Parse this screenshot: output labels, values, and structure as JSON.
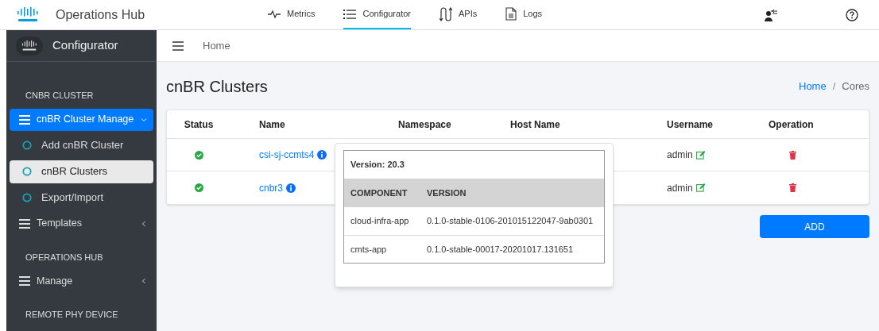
{
  "app": {
    "title": "Operations Hub"
  },
  "nav": [
    {
      "label": "Metrics",
      "kind": "metrics",
      "selected": false
    },
    {
      "label": "Configurator",
      "kind": "list",
      "selected": true
    },
    {
      "label": "APIs",
      "kind": "apis",
      "selected": false
    },
    {
      "label": "Logs",
      "kind": "logs",
      "selected": false
    }
  ],
  "sidebar": {
    "title": "Configurator",
    "sections": [
      {
        "heading": "CNBR CLUSTER",
        "items": [
          {
            "label": "cnBR Cluster Manage",
            "kind": "group",
            "expanded": true,
            "selected": true
          },
          {
            "label": "Add cnBR Cluster",
            "kind": "link",
            "selected": false
          },
          {
            "label": "cnBR Clusters",
            "kind": "link",
            "selected": true
          },
          {
            "label": "Export/Import",
            "kind": "link",
            "selected": false
          },
          {
            "label": "Templates",
            "kind": "group",
            "expanded": false,
            "selected": false
          }
        ]
      },
      {
        "heading": "OPERATIONS HUB",
        "items": [
          {
            "label": "Manage",
            "kind": "group",
            "expanded": false,
            "selected": false
          }
        ]
      },
      {
        "heading": "REMOTE PHY DEVICE"
      }
    ]
  },
  "subheader": {
    "label": "Home"
  },
  "page": {
    "title": "cnBR Clusters",
    "breadcrumb_separator": "/",
    "breadcrumb": [
      {
        "label": "Home",
        "kind": "link"
      },
      {
        "label": "Cores",
        "kind": "current"
      }
    ]
  },
  "table": {
    "columns": [
      "Status",
      "Name",
      "Namespace",
      "Host Name",
      "Username",
      "Operation"
    ],
    "rows": [
      {
        "ok": true,
        "name": "csi-sj-ccmts4",
        "username": "admin"
      },
      {
        "ok": true,
        "name": "cnbr3",
        "username": "admin"
      }
    ]
  },
  "popover": {
    "version": "Version: 20.3",
    "columns": [
      "COMPONENT",
      "VERSION"
    ],
    "rows": [
      [
        "cloud-infra-app",
        "0.1.0-stable-0106-201015122047-9ab0301"
      ],
      [
        "cmts-app",
        "0.1.0-stable-00017-20201017.131651"
      ]
    ]
  },
  "add_button": "ADD"
}
